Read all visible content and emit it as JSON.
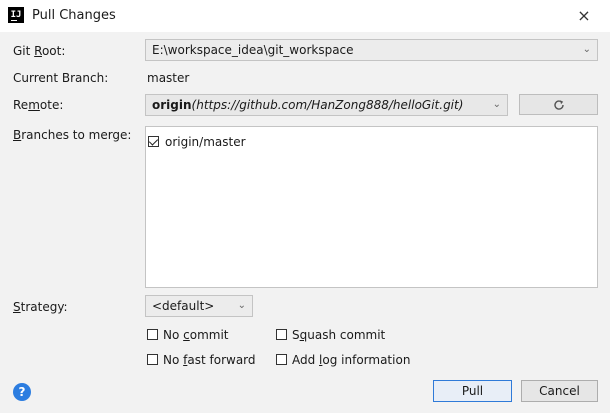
{
  "window": {
    "title": "Pull Changes",
    "app_icon": "intellij-icon",
    "close_icon": "×"
  },
  "git_root": {
    "label_pre": "Git ",
    "label_mnemonic": "R",
    "label_post": "oot:",
    "value": "E:\\workspace_idea\\git_workspace"
  },
  "current_branch": {
    "label": "Current Branch:",
    "value": "master"
  },
  "remote": {
    "label_pre": "Re",
    "label_mnemonic": "m",
    "label_post": "ote:",
    "name": "origin",
    "url": "(https://github.com/HanZong888/helloGit.git)",
    "refresh_icon": "refresh-icon"
  },
  "branches": {
    "label_pre": "",
    "label_mnemonic": "B",
    "label_post": "ranches to merge:",
    "items": [
      {
        "label": "origin/master",
        "checked": true
      }
    ]
  },
  "strategy": {
    "label_pre": "",
    "label_mnemonic": "S",
    "label_post": "trategy:",
    "value": "<default>"
  },
  "options": {
    "no_commit": {
      "pre": "No ",
      "mnemonic": "c",
      "post": "ommit",
      "checked": false
    },
    "squash_commit": {
      "pre": "S",
      "mnemonic": "q",
      "post": "uash commit",
      "checked": false
    },
    "no_fast_forward": {
      "pre": "No ",
      "mnemonic": "f",
      "post": "ast forward",
      "checked": false
    },
    "add_log": {
      "pre": "Add ",
      "mnemonic": "l",
      "post": "og information",
      "checked": false
    }
  },
  "footer": {
    "help_icon": "?",
    "pull_label": "Pull",
    "cancel_label": "Cancel"
  }
}
